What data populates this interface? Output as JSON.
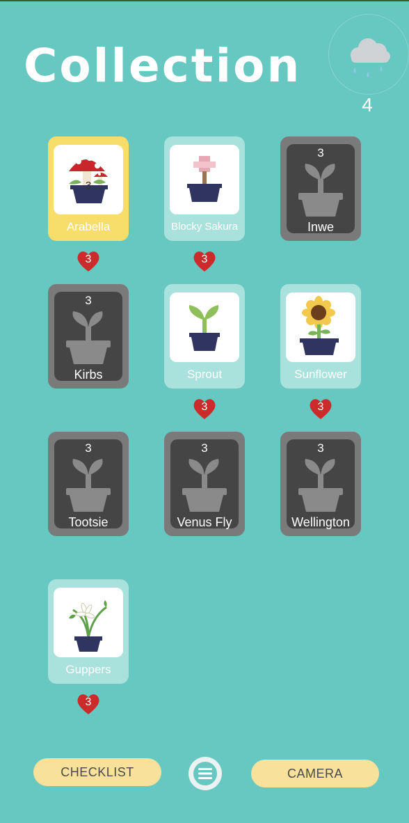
{
  "title": "Collection",
  "rain": {
    "count": "4",
    "icon": "rain-cloud-icon"
  },
  "cards": [
    {
      "name": "Arabella",
      "style": "yellow",
      "icon": "mushroom-plant-icon",
      "overlay": "3",
      "hearts": "3"
    },
    {
      "name": "Blocky Sakura",
      "style": "teal",
      "icon": "blocky-sakura-plant-icon",
      "hearts": "3"
    },
    {
      "name": "Inwe",
      "style": "gray",
      "icon": "locked-plant-silhouette-icon",
      "level": "3"
    },
    {
      "name": "Kirbs",
      "style": "gray",
      "icon": "locked-plant-silhouette-icon",
      "level": "3"
    },
    {
      "name": "Sprout",
      "style": "teal",
      "icon": "sprout-plant-icon",
      "hearts": "3"
    },
    {
      "name": "Sunflower",
      "style": "teal",
      "icon": "sunflower-plant-icon",
      "hearts": "3"
    },
    {
      "name": "Tootsie",
      "style": "gray",
      "icon": "locked-plant-silhouette-icon",
      "level": "3"
    },
    {
      "name": "Venus Fly",
      "style": "gray",
      "icon": "locked-plant-silhouette-icon",
      "level": "3"
    },
    {
      "name": "Wellington",
      "style": "gray",
      "icon": "locked-plant-silhouette-icon",
      "level": "3"
    },
    {
      "name": "Guppers",
      "style": "teal",
      "icon": "guppers-plant-icon",
      "hearts": "3"
    }
  ],
  "buttons": {
    "checklist": "CHECKLIST",
    "camera": "CAMERA",
    "menu_icon": "hamburger-menu-icon"
  },
  "colors": {
    "background": "#67c8c2",
    "card_unlocked": "#a9e1dc",
    "card_selected": "#f7dd6a",
    "card_locked": "#7a7a7a",
    "heart": "#cc2b2b",
    "button": "#f8e19b"
  }
}
